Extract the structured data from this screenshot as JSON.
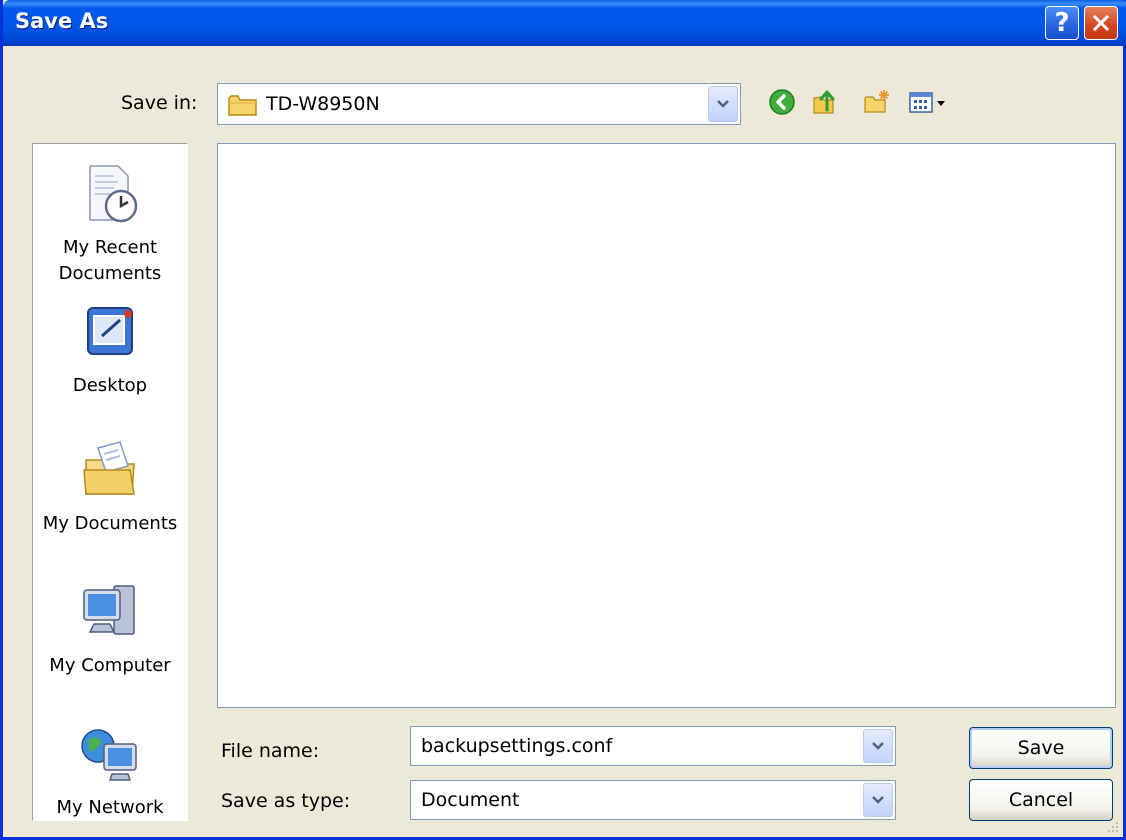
{
  "window": {
    "title": "Save As"
  },
  "save_in": {
    "label": "Save in:",
    "value": "TD-W8950N"
  },
  "places": [
    {
      "label_line1": "My Recent",
      "label_line2": "Documents"
    },
    {
      "label_line1": "Desktop"
    },
    {
      "label_line1": "My Documents"
    },
    {
      "label_line1": "My Computer"
    },
    {
      "label_line1": "My Network"
    }
  ],
  "file_name": {
    "label": "File name:",
    "value": "backupsettings.conf"
  },
  "save_as_type": {
    "label": "Save as type:",
    "value": "Document"
  },
  "buttons": {
    "save": "Save",
    "cancel": "Cancel",
    "help": "?"
  },
  "colors": {
    "titlebar": "#0058EE",
    "dialog_bg": "#ECE9D8",
    "border": "#0831D9"
  },
  "icons": [
    "back-icon",
    "up-folder-icon",
    "new-folder-icon",
    "views-menu-icon"
  ]
}
